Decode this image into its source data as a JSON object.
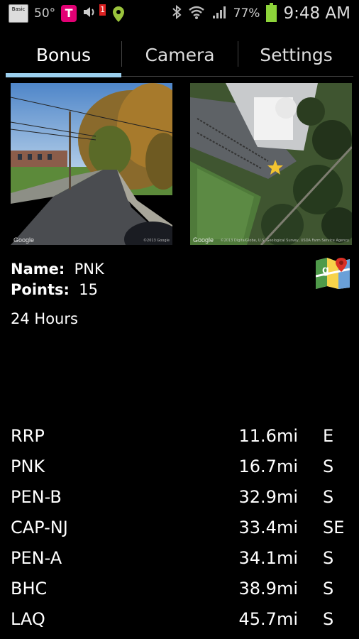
{
  "status_bar": {
    "app_badge": "Basic",
    "temperature": "50°",
    "carrier_icon": "T",
    "notification_count": "1",
    "battery_percent": "77%",
    "time": "9:48 AM"
  },
  "tabs": [
    {
      "label": "Bonus",
      "active": true
    },
    {
      "label": "Camera",
      "active": false
    },
    {
      "label": "Settings",
      "active": false
    }
  ],
  "images": {
    "street_view_credit": "Google",
    "street_view_copyright": "©2013 Google",
    "satellite_credit": "Google",
    "satellite_copyright": "©2013 DigitalGlobe, U.S. Geological Survey, USDA Farm Service Agency"
  },
  "bonus": {
    "name_label": "Name:",
    "name_value": "PNK",
    "points_label": "Points:",
    "points_value": "15",
    "hours": "24 Hours"
  },
  "nearby": [
    {
      "code": "RRP",
      "distance": "11.6mi",
      "direction": "E"
    },
    {
      "code": "PNK",
      "distance": "16.7mi",
      "direction": "S"
    },
    {
      "code": "PEN-B",
      "distance": "32.9mi",
      "direction": "S"
    },
    {
      "code": "CAP-NJ",
      "distance": "33.4mi",
      "direction": "SE"
    },
    {
      "code": "PEN-A",
      "distance": "34.1mi",
      "direction": "S"
    },
    {
      "code": "BHC",
      "distance": "38.9mi",
      "direction": "S"
    },
    {
      "code": "LAQ",
      "distance": "45.7mi",
      "direction": "S"
    }
  ],
  "colors": {
    "tab_indicator": "#9bcfee",
    "battery": "#8dd43a",
    "background": "#000000"
  }
}
